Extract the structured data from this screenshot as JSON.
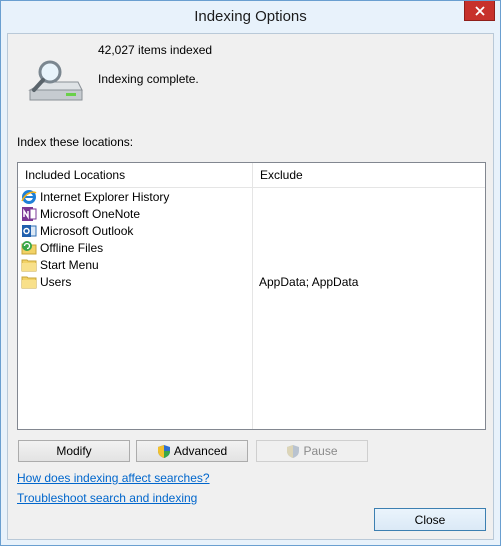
{
  "window": {
    "title": "Indexing Options",
    "close_glyph": "✕"
  },
  "status": {
    "items_indexed": "42,027 items indexed",
    "state": "Indexing complete."
  },
  "locations_label": "Index these locations:",
  "table": {
    "columns": [
      "Included Locations",
      "Exclude"
    ],
    "rows": [
      {
        "name": "Internet Explorer History",
        "exclude": "",
        "icon": "internet-explorer-icon"
      },
      {
        "name": "Microsoft OneNote",
        "exclude": "",
        "icon": "onenote-icon"
      },
      {
        "name": "Microsoft Outlook",
        "exclude": "",
        "icon": "outlook-icon"
      },
      {
        "name": "Offline Files",
        "exclude": "",
        "icon": "offline-files-icon"
      },
      {
        "name": "Start Menu",
        "exclude": "",
        "icon": "folder-icon"
      },
      {
        "name": "Users",
        "exclude": "AppData; AppData",
        "icon": "folder-icon"
      }
    ]
  },
  "buttons": {
    "modify": "Modify",
    "advanced": "Advanced",
    "pause": "Pause",
    "close": "Close"
  },
  "links": {
    "how_affects": "How does indexing affect searches?",
    "troubleshoot": "Troubleshoot search and indexing"
  },
  "colors": {
    "accent": "#0066cc",
    "title_close": "#c7312b"
  }
}
